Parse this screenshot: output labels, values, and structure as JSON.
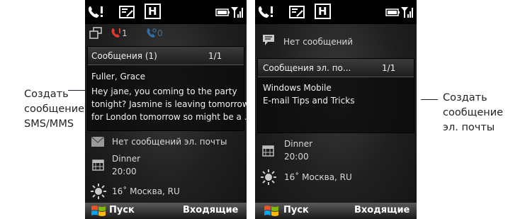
{
  "callouts": {
    "left": [
      "Создать",
      "сообщение",
      "SMS/MMS"
    ],
    "right": [
      "Создать",
      "сообщение",
      "эл. почты"
    ]
  },
  "screen1": {
    "missed_calls_count": "1",
    "voicemail_count": "0",
    "messages_header": "Сообщения  (1)",
    "messages_page": "1/1",
    "sender": "Fuller, Grace",
    "preview_lines": [
      "Hey jane, you coming to the party",
      "tonight? Jasmine is leaving tomorrow",
      "for London tomorrow so might be a ..."
    ],
    "email_status": "Нет сообщений эл. почты",
    "calendar_title": "Dinner",
    "calendar_time": "20:00",
    "weather": "16˚ Москва, RU",
    "softkey_left": "Пуск",
    "softkey_right": "Входящие"
  },
  "screen2": {
    "sms_status": "Нет сообщений",
    "email_header": "Сообщения эл. по...",
    "email_page": "1/1",
    "email_lines": [
      "Windows Mobile",
      "E-mail Tips and Tricks"
    ],
    "calendar_title": "Dinner",
    "calendar_time": "20:00",
    "weather": "16˚ Москва, RU",
    "softkey_left": "Пуск",
    "softkey_right": "Входящие"
  },
  "status_bar": {
    "h_indicator": "H"
  },
  "colors": {
    "missed_call": "#e53a2f",
    "voicemail": "#3a8ad0",
    "windows_flag": [
      "#f25022",
      "#7fba00",
      "#00a4ef",
      "#ffb900"
    ]
  }
}
